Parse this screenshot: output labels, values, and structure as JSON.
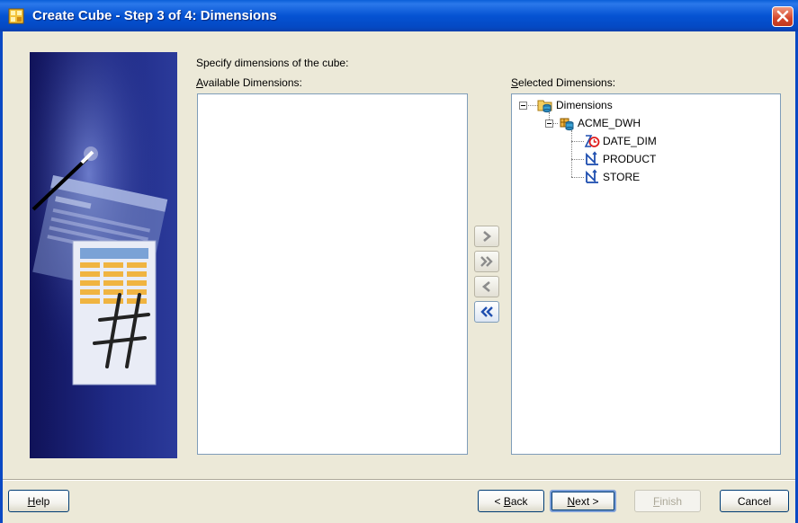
{
  "window": {
    "title": "Create Cube - Step 3 of 4: Dimensions"
  },
  "instructions": "Specify dimensions of the cube:",
  "available": {
    "label_accel": "A",
    "label_rest": "vailable Dimensions:"
  },
  "selected": {
    "label_accel": "S",
    "label_rest": "elected Dimensions:",
    "tree": {
      "root": "Dimensions",
      "schema": "ACME_DWH",
      "items": [
        "DATE_DIM",
        "PRODUCT",
        "STORE"
      ]
    }
  },
  "buttons": {
    "help_accel": "H",
    "help_rest": "elp",
    "back_prefix": "< ",
    "back_accel": "B",
    "back_rest": "ack",
    "next_accel": "N",
    "next_rest": "ext >",
    "finish_accel": "F",
    "finish_rest": "inish",
    "cancel": "Cancel"
  },
  "icons": {
    "add": "chevron-right-icon",
    "add_all": "double-chevron-right-icon",
    "remove": "chevron-left-icon",
    "remove_all": "double-chevron-left-icon"
  },
  "colors": {
    "titlebar": "#0553d3",
    "dialog": "#ece9d8",
    "banner": "#1f2a86",
    "close": "#d4452a"
  }
}
